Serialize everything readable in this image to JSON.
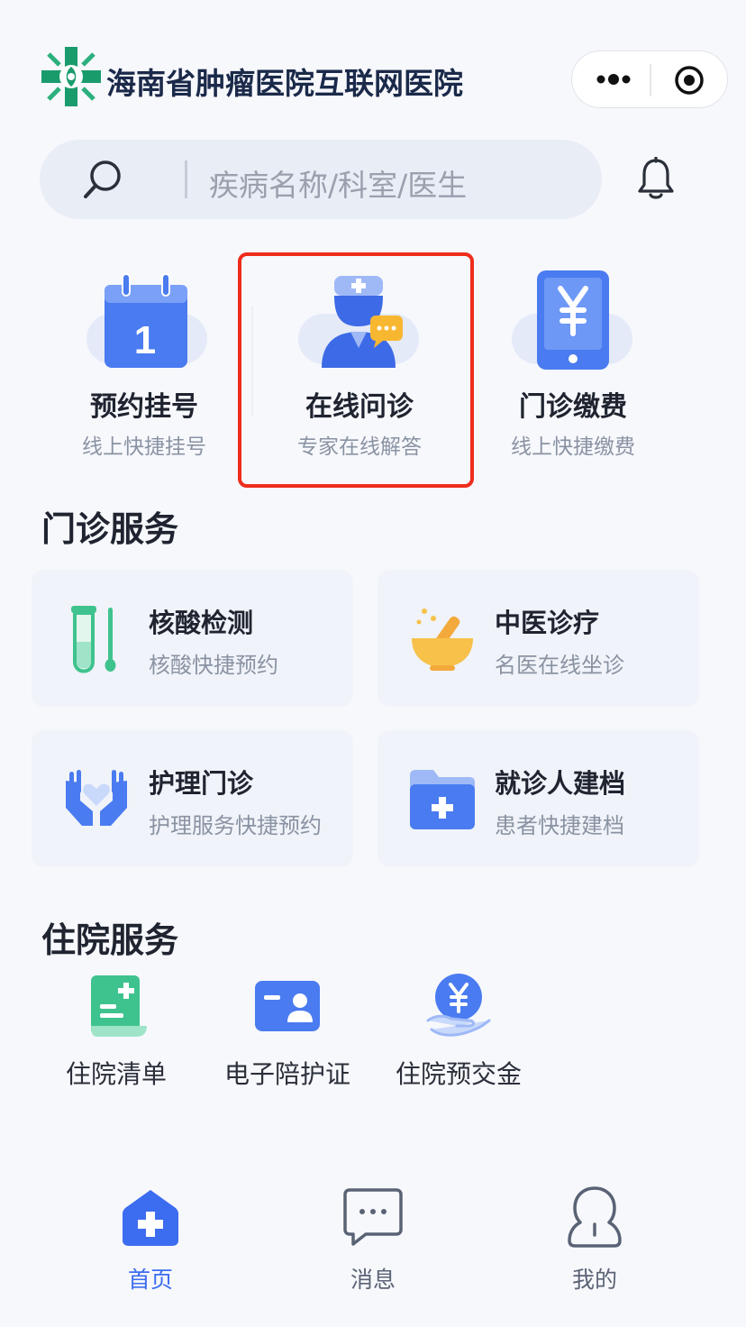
{
  "header": {
    "title": "海南省肿瘤医院互联网医院"
  },
  "search": {
    "placeholder": "疾病名称/科室/医生"
  },
  "quick_entries": [
    {
      "title": "预约挂号",
      "subtitle": "线上快捷挂号",
      "icon": "calendar-icon"
    },
    {
      "title": "在线问诊",
      "subtitle": "专家在线解答",
      "icon": "doctor-chat-icon"
    },
    {
      "title": "门诊缴费",
      "subtitle": "线上快捷缴费",
      "icon": "yuan-phone-icon"
    }
  ],
  "calendar_day": "1",
  "sections": {
    "outpatient": "门诊服务",
    "inpatient": "住院服务"
  },
  "outpatient_services": [
    {
      "title": "核酸检测",
      "subtitle": "核酸快捷预约",
      "icon": "test-tube-icon"
    },
    {
      "title": "中医诊疗",
      "subtitle": "名医在线坐诊",
      "icon": "mortar-icon"
    },
    {
      "title": "护理门诊",
      "subtitle": "护理服务快捷预约",
      "icon": "care-hands-icon"
    },
    {
      "title": "就诊人建档",
      "subtitle": "患者快捷建档",
      "icon": "folder-plus-icon"
    }
  ],
  "inpatient_services": [
    {
      "label": "住院清单",
      "icon": "list-scroll-icon"
    },
    {
      "label": "电子陪护证",
      "icon": "id-card-icon"
    },
    {
      "label": "住院预交金",
      "icon": "yuan-hand-icon"
    }
  ],
  "tabs": [
    {
      "label": "首页",
      "icon": "home-icon",
      "active": true
    },
    {
      "label": "消息",
      "icon": "message-icon",
      "active": false
    },
    {
      "label": "我的",
      "icon": "user-icon",
      "active": false
    }
  ],
  "colors": {
    "accent": "#3c6cf0",
    "highlight_border": "#ef2d1c",
    "background": "#f7f8fc",
    "card_background": "#f0f3f9"
  }
}
